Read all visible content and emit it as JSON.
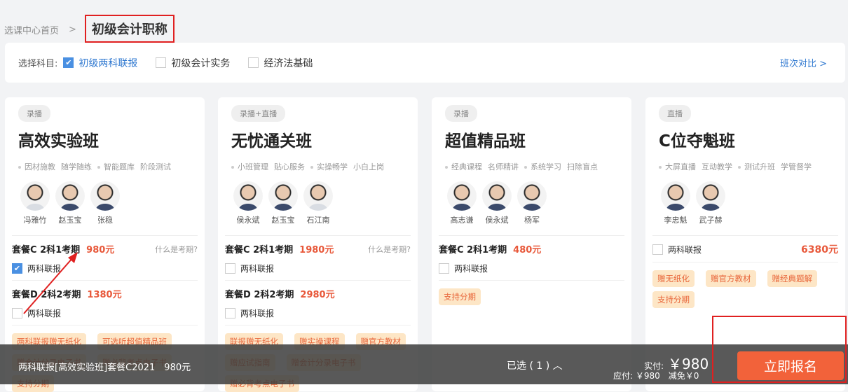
{
  "breadcrumb": {
    "home": "选课中心首页",
    "sep": ">",
    "current": "初级会计职称"
  },
  "filter": {
    "label": "选择科目:",
    "options": [
      {
        "label": "初级两科联报",
        "checked": true
      },
      {
        "label": "初级会计实务",
        "checked": false
      },
      {
        "label": "经济法基础",
        "checked": false
      }
    ],
    "compare": "班次对比 >"
  },
  "cards": [
    {
      "type": "录播",
      "title": "高效实验班",
      "features": [
        "因材施教",
        "随学随练",
        "智能题库",
        "阶段测试"
      ],
      "teachers": [
        {
          "name": "冯雅竹",
          "f": true
        },
        {
          "name": "赵玉宝"
        },
        {
          "name": "张稳"
        }
      ],
      "packages": [
        {
          "name": "套餐C 2科1考期",
          "price": "980元",
          "help": "什么是考期?",
          "option": "两科联报",
          "checked": true
        },
        {
          "name": "套餐D 2科2考期",
          "price": "1380元",
          "option": "两科联报",
          "checked": false
        }
      ],
      "gifts": [
        "两科联报赠无纸化",
        "可选听超值精品班",
        "赠会计分录电子书",
        "赠必背考点电子书",
        "支持分期"
      ]
    },
    {
      "type": "录播+直播",
      "title": "无忧通关班",
      "features": [
        "小班管理",
        "贴心服务",
        "实操畅学",
        "小白上岗"
      ],
      "teachers": [
        {
          "name": "侯永斌"
        },
        {
          "name": "赵玉宝"
        },
        {
          "name": "石江南",
          "f": true
        }
      ],
      "packages": [
        {
          "name": "套餐C 2科1考期",
          "price": "1980元",
          "help": "什么是考期?",
          "option": "两科联报",
          "checked": false
        },
        {
          "name": "套餐D 2科2考期",
          "price": "2980元",
          "option": "两科联报",
          "checked": false
        }
      ],
      "gifts": [
        "联报赠无纸化",
        "赠实操课程",
        "赠官方教材",
        "赠应试指南",
        "赠会计分录电子书",
        "赠必背考点电子书"
      ]
    },
    {
      "type": "录播",
      "title": "超值精品班",
      "features": [
        "经典课程",
        "名师精讲",
        "系统学习",
        "扫除盲点"
      ],
      "teachers": [
        {
          "name": "高志谦"
        },
        {
          "name": "侯永斌"
        },
        {
          "name": "杨军"
        }
      ],
      "packages": [
        {
          "name": "套餐C 2科1考期",
          "price": "480元",
          "option": "两科联报",
          "checked": false
        }
      ],
      "gifts": [
        "支持分期"
      ]
    },
    {
      "type": "直播",
      "title": "C位夺魁班",
      "features": [
        "大屏直播",
        "互动教学",
        "测试升班",
        "学管督学"
      ],
      "teachers": [
        {
          "name": "李忠魁"
        },
        {
          "name": "武子赫"
        }
      ],
      "packages": [
        {
          "option": "两科联报",
          "price": "6380元",
          "checked": false
        }
      ],
      "gifts": [
        "赠无纸化",
        "赠官方教材",
        "赠经典题解",
        "支持分期"
      ]
    }
  ],
  "bottom_bar": {
    "selection": "两科联报[高效实验班]套餐C2021　980元",
    "selected_count": "已选 ( 1 ) ︿",
    "paid_label": "实付:",
    "paid": "￥980",
    "due": "应付: ￥980　减免￥0",
    "enroll": "立即报名"
  }
}
